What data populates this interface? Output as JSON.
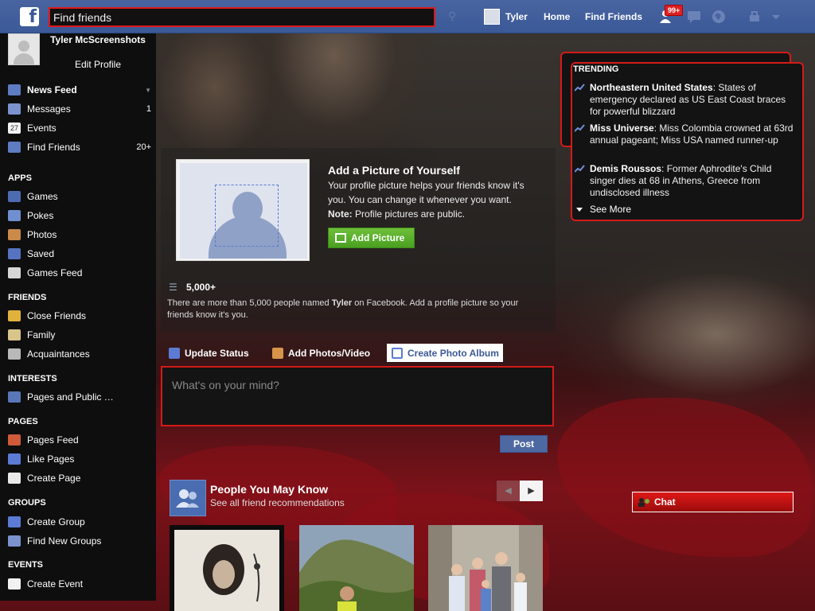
{
  "topbar": {
    "logo": "f",
    "search_placeholder": "Find friends",
    "user_name": "Tyler",
    "home_label": "Home",
    "find_friends_label": "Find Friends",
    "notification_badge": "99+"
  },
  "sidebar": {
    "profile_name": "Tyler McScreenshots",
    "edit_profile": "Edit Profile",
    "favorites": [
      {
        "label": "News Feed",
        "count": ""
      },
      {
        "label": "Messages",
        "count": "1"
      },
      {
        "label": "Events",
        "count": ""
      },
      {
        "label": "Find Friends",
        "count": "20+"
      }
    ],
    "apps_head": "APPS",
    "apps": [
      "Games",
      "Pokes",
      "Photos",
      "Saved",
      "Games Feed"
    ],
    "friends_head": "FRIENDS",
    "friends": [
      "Close Friends",
      "Family",
      "Acquaintances"
    ],
    "interests_head": "INTERESTS",
    "interests": [
      "Pages and Public …"
    ],
    "pages_head": "PAGES",
    "pages": [
      "Pages Feed",
      "Like Pages",
      "Create Page"
    ],
    "groups_head": "GROUPS",
    "groups": [
      "Create Group",
      "Find New Groups"
    ],
    "events_head": "EVENTS",
    "events": [
      "Create Event"
    ],
    "events_icon_text": "27"
  },
  "prompt": {
    "title": "Add a Picture of Yourself",
    "desc_1": "Your profile picture helps your friends know it's you. You can change it whenever you want.",
    "note_label": "Note:",
    "note_text": "Profile pictures are public.",
    "button": "Add Picture",
    "count": "5,000+",
    "count_desc_1": "There are more than 5,000 people named",
    "count_desc_name": "Tyler",
    "count_desc_2": "on Facebook. Add a profile picture so your friends know it's you."
  },
  "composer": {
    "tab_status": "Update Status",
    "tab_photos": "Add Photos/Video",
    "tab_album": "Create Photo Album",
    "placeholder": "What's on your mind?",
    "post": "Post"
  },
  "pymk": {
    "title": "People You May Know",
    "subtitle": "See all friend recommendations"
  },
  "trending": {
    "head": "TRENDING",
    "items": [
      {
        "topic": "Northeastern United States",
        "text": ": States of emergency declared as US East Coast braces for powerful blizzard"
      },
      {
        "topic": "Miss Universe",
        "text": ": Miss Colombia crowned at 63rd annual pageant; Miss USA named runner-up"
      },
      {
        "topic": "Demis Roussos",
        "text": ": Former Aphrodite's Child singer dies at 68 in Athens, Greece from undisclosed illness"
      }
    ],
    "see_more": "See More"
  },
  "chat": {
    "label": "Chat"
  },
  "colors": {
    "brand": "#3b5998",
    "highlight_red": "#d41a1a",
    "add_button_green": "#4aa021"
  }
}
